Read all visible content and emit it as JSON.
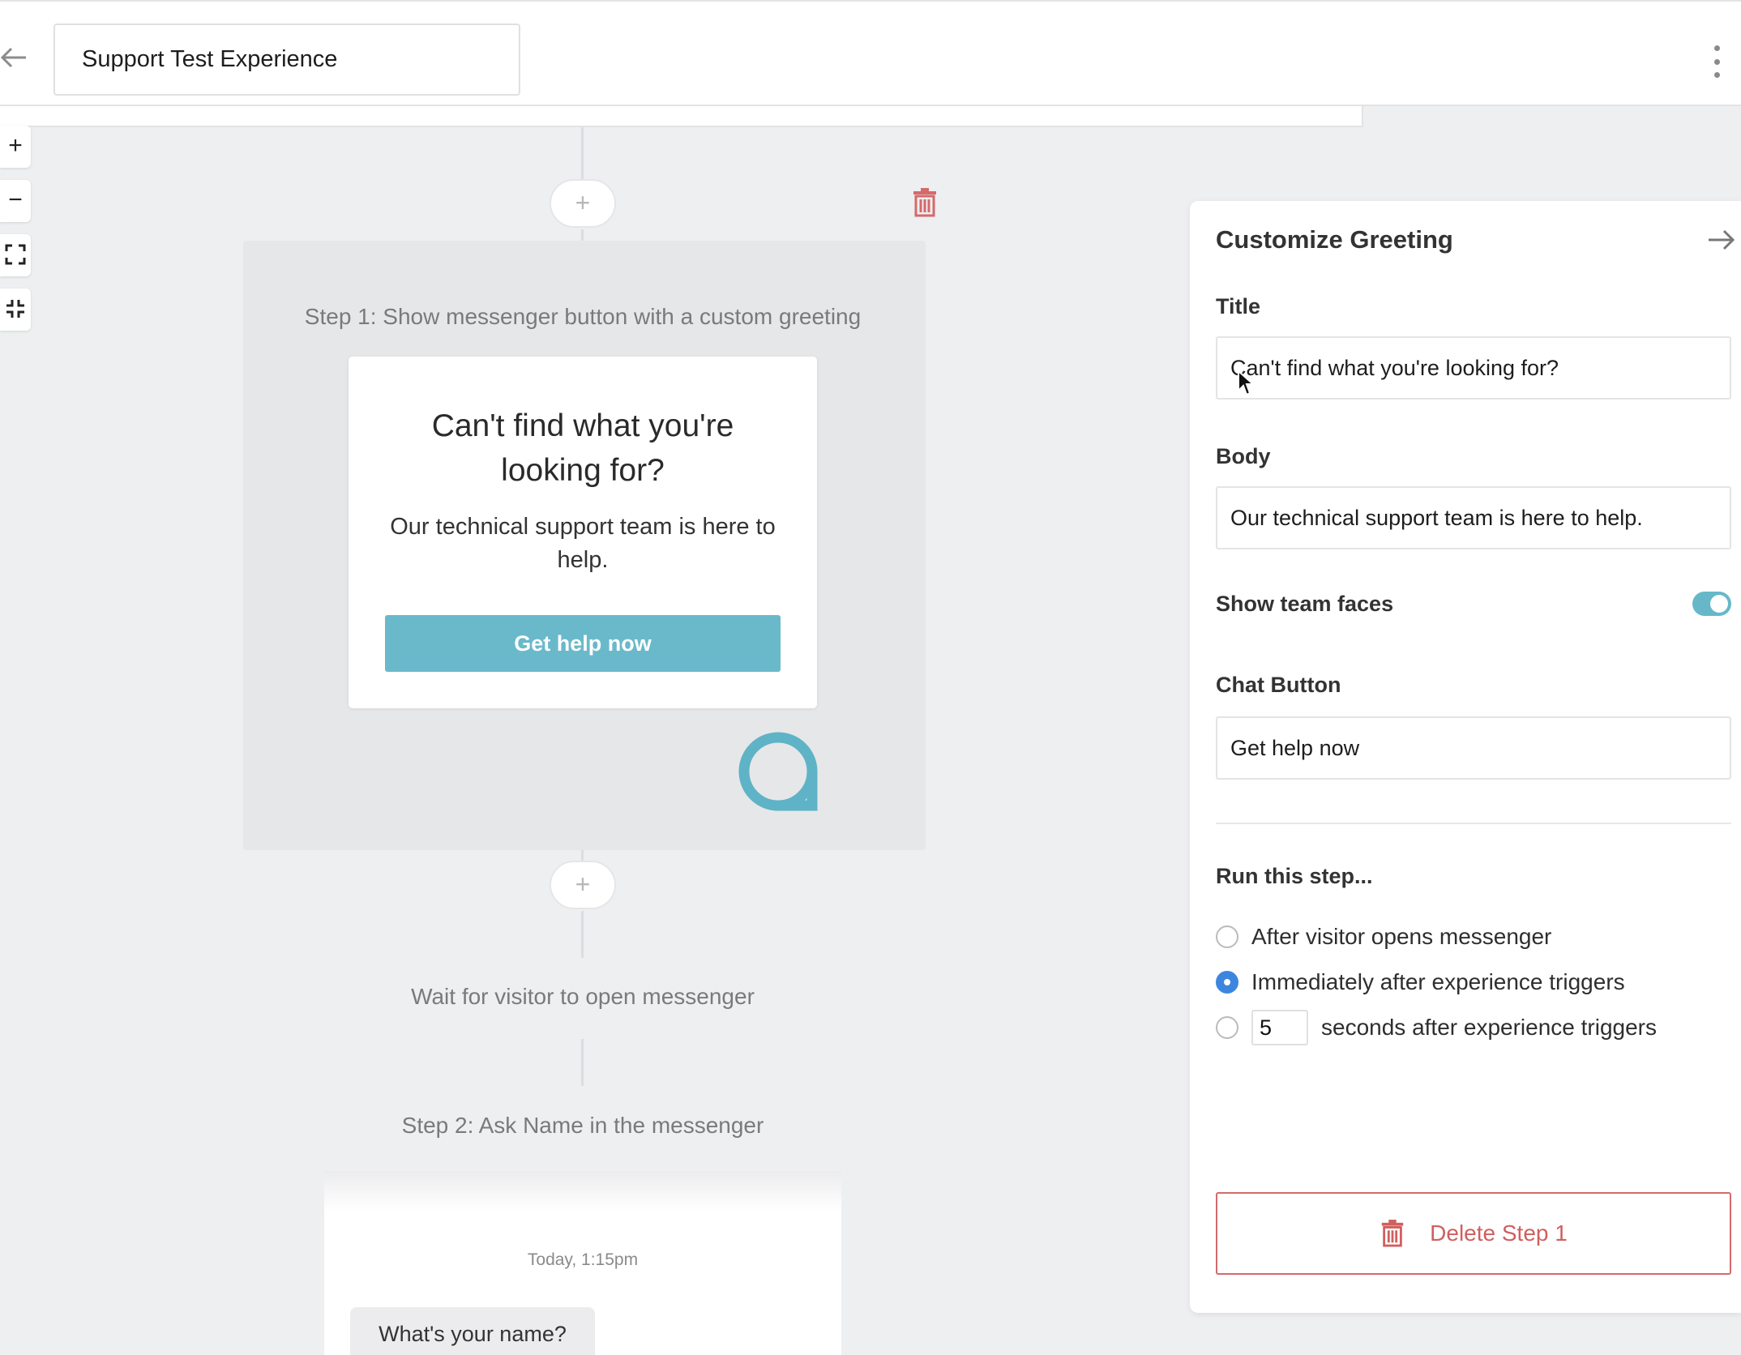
{
  "header": {
    "experience_name": "Support Test Experience",
    "back_icon": "arrow-left-icon",
    "menu_icon": "kebab-menu-icon"
  },
  "zoom_controls": {
    "zoom_in": "+",
    "zoom_out": "−",
    "fit_icon": "fullscreen-icon",
    "collapse_icon": "collapse-icon"
  },
  "canvas": {
    "add_step_symbol": "+",
    "step1": {
      "label": "Step 1: Show messenger button with a custom greeting",
      "greeting_title": "Can't find what you're looking for?",
      "greeting_body": "Our technical support team is here to help.",
      "greeting_button": "Get help now"
    },
    "wait_label": "Wait for visitor to open messenger",
    "step2": {
      "label": "Step 2: Ask Name in the messenger",
      "timestamp": "Today, 1:15pm",
      "message": "What's your name?"
    }
  },
  "panel": {
    "title": "Customize Greeting",
    "title_label": "Title",
    "title_value": "Can't find what you're looking for?",
    "body_label": "Body",
    "body_value": "Our technical support team is here to help.",
    "team_faces_label": "Show team faces",
    "team_faces_enabled": true,
    "chat_button_label": "Chat Button",
    "chat_button_value": "Get help now",
    "run_label": "Run this step...",
    "run_options": [
      {
        "label": "After visitor opens messenger",
        "checked": false
      },
      {
        "label": "Immediately after experience triggers",
        "checked": true
      },
      {
        "label": "seconds after experience triggers",
        "checked": false
      }
    ],
    "seconds_value": "5",
    "delete_label": "Delete Step 1"
  },
  "colors": {
    "accent_teal": "#69b9cb",
    "radio_blue": "#3d86e0",
    "danger_red": "#d05f5f"
  }
}
